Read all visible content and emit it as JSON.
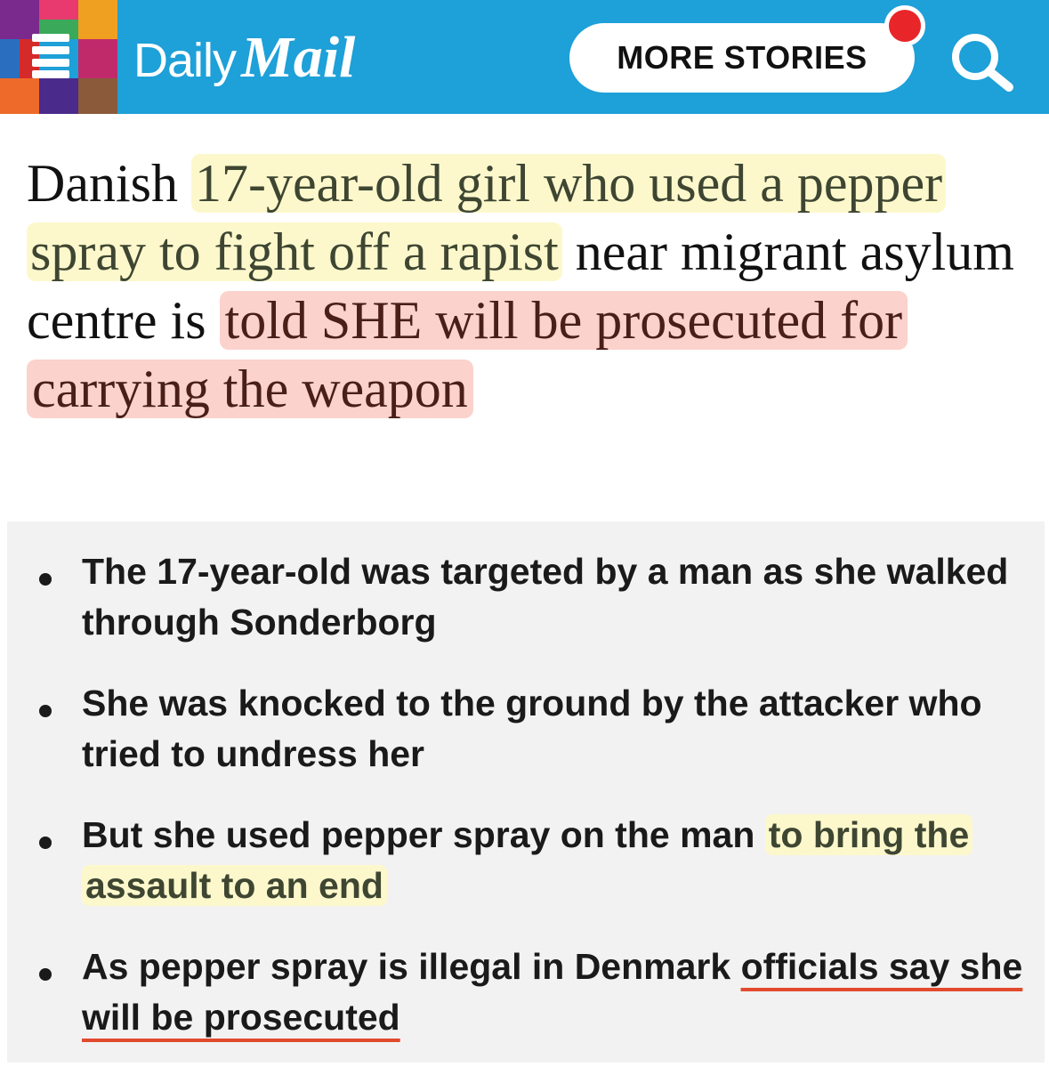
{
  "header": {
    "logo_left": "Daily",
    "logo_right": "Mail",
    "more_stories_label": "MORE STORIES",
    "background_color": "#1ea0d8",
    "notification_color": "#e8262a",
    "menu_icon": "hamburger-menu-icon",
    "search_icon": "search-icon"
  },
  "headline": {
    "part1": "Danish ",
    "highlight_yellow": "17-year-old girl who used a pepper spray to fight off a rapist",
    "part2": " near migrant asylum centre is ",
    "highlight_pink": "told SHE will be prosecuted for carrying the weapon"
  },
  "bullets": [
    {
      "text": "The 17-year-old was targeted by a man as she walked through Sonderborg"
    },
    {
      "text": "She was knocked to the ground by the attacker who tried to undress her"
    },
    {
      "before": "But she used pepper spray on the man ",
      "highlight": "to bring the assault to an end"
    },
    {
      "before": "As pepper spray is illegal in Denmark ",
      "underlined": "officials say she will be prosecuted"
    }
  ],
  "colors": {
    "yellow_highlight": "#fdf8cc",
    "pink_highlight": "#fbd2cc",
    "underline_red": "#e14a2d",
    "bullet_box_bg": "#f2f2f2"
  }
}
